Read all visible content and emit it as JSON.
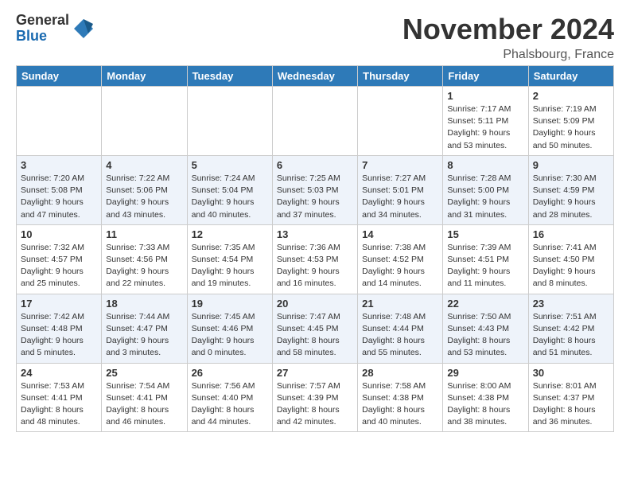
{
  "logo": {
    "general": "General",
    "blue": "Blue"
  },
  "header": {
    "title": "November 2024",
    "location": "Phalsbourg, France"
  },
  "weekdays": [
    "Sunday",
    "Monday",
    "Tuesday",
    "Wednesday",
    "Thursday",
    "Friday",
    "Saturday"
  ],
  "weeks": [
    [
      {
        "day": "",
        "info": ""
      },
      {
        "day": "",
        "info": ""
      },
      {
        "day": "",
        "info": ""
      },
      {
        "day": "",
        "info": ""
      },
      {
        "day": "",
        "info": ""
      },
      {
        "day": "1",
        "info": "Sunrise: 7:17 AM\nSunset: 5:11 PM\nDaylight: 9 hours and 53 minutes."
      },
      {
        "day": "2",
        "info": "Sunrise: 7:19 AM\nSunset: 5:09 PM\nDaylight: 9 hours and 50 minutes."
      }
    ],
    [
      {
        "day": "3",
        "info": "Sunrise: 7:20 AM\nSunset: 5:08 PM\nDaylight: 9 hours and 47 minutes."
      },
      {
        "day": "4",
        "info": "Sunrise: 7:22 AM\nSunset: 5:06 PM\nDaylight: 9 hours and 43 minutes."
      },
      {
        "day": "5",
        "info": "Sunrise: 7:24 AM\nSunset: 5:04 PM\nDaylight: 9 hours and 40 minutes."
      },
      {
        "day": "6",
        "info": "Sunrise: 7:25 AM\nSunset: 5:03 PM\nDaylight: 9 hours and 37 minutes."
      },
      {
        "day": "7",
        "info": "Sunrise: 7:27 AM\nSunset: 5:01 PM\nDaylight: 9 hours and 34 minutes."
      },
      {
        "day": "8",
        "info": "Sunrise: 7:28 AM\nSunset: 5:00 PM\nDaylight: 9 hours and 31 minutes."
      },
      {
        "day": "9",
        "info": "Sunrise: 7:30 AM\nSunset: 4:59 PM\nDaylight: 9 hours and 28 minutes."
      }
    ],
    [
      {
        "day": "10",
        "info": "Sunrise: 7:32 AM\nSunset: 4:57 PM\nDaylight: 9 hours and 25 minutes."
      },
      {
        "day": "11",
        "info": "Sunrise: 7:33 AM\nSunset: 4:56 PM\nDaylight: 9 hours and 22 minutes."
      },
      {
        "day": "12",
        "info": "Sunrise: 7:35 AM\nSunset: 4:54 PM\nDaylight: 9 hours and 19 minutes."
      },
      {
        "day": "13",
        "info": "Sunrise: 7:36 AM\nSunset: 4:53 PM\nDaylight: 9 hours and 16 minutes."
      },
      {
        "day": "14",
        "info": "Sunrise: 7:38 AM\nSunset: 4:52 PM\nDaylight: 9 hours and 14 minutes."
      },
      {
        "day": "15",
        "info": "Sunrise: 7:39 AM\nSunset: 4:51 PM\nDaylight: 9 hours and 11 minutes."
      },
      {
        "day": "16",
        "info": "Sunrise: 7:41 AM\nSunset: 4:50 PM\nDaylight: 9 hours and 8 minutes."
      }
    ],
    [
      {
        "day": "17",
        "info": "Sunrise: 7:42 AM\nSunset: 4:48 PM\nDaylight: 9 hours and 5 minutes."
      },
      {
        "day": "18",
        "info": "Sunrise: 7:44 AM\nSunset: 4:47 PM\nDaylight: 9 hours and 3 minutes."
      },
      {
        "day": "19",
        "info": "Sunrise: 7:45 AM\nSunset: 4:46 PM\nDaylight: 9 hours and 0 minutes."
      },
      {
        "day": "20",
        "info": "Sunrise: 7:47 AM\nSunset: 4:45 PM\nDaylight: 8 hours and 58 minutes."
      },
      {
        "day": "21",
        "info": "Sunrise: 7:48 AM\nSunset: 4:44 PM\nDaylight: 8 hours and 55 minutes."
      },
      {
        "day": "22",
        "info": "Sunrise: 7:50 AM\nSunset: 4:43 PM\nDaylight: 8 hours and 53 minutes."
      },
      {
        "day": "23",
        "info": "Sunrise: 7:51 AM\nSunset: 4:42 PM\nDaylight: 8 hours and 51 minutes."
      }
    ],
    [
      {
        "day": "24",
        "info": "Sunrise: 7:53 AM\nSunset: 4:41 PM\nDaylight: 8 hours and 48 minutes."
      },
      {
        "day": "25",
        "info": "Sunrise: 7:54 AM\nSunset: 4:41 PM\nDaylight: 8 hours and 46 minutes."
      },
      {
        "day": "26",
        "info": "Sunrise: 7:56 AM\nSunset: 4:40 PM\nDaylight: 8 hours and 44 minutes."
      },
      {
        "day": "27",
        "info": "Sunrise: 7:57 AM\nSunset: 4:39 PM\nDaylight: 8 hours and 42 minutes."
      },
      {
        "day": "28",
        "info": "Sunrise: 7:58 AM\nSunset: 4:38 PM\nDaylight: 8 hours and 40 minutes."
      },
      {
        "day": "29",
        "info": "Sunrise: 8:00 AM\nSunset: 4:38 PM\nDaylight: 8 hours and 38 minutes."
      },
      {
        "day": "30",
        "info": "Sunrise: 8:01 AM\nSunset: 4:37 PM\nDaylight: 8 hours and 36 minutes."
      }
    ]
  ]
}
